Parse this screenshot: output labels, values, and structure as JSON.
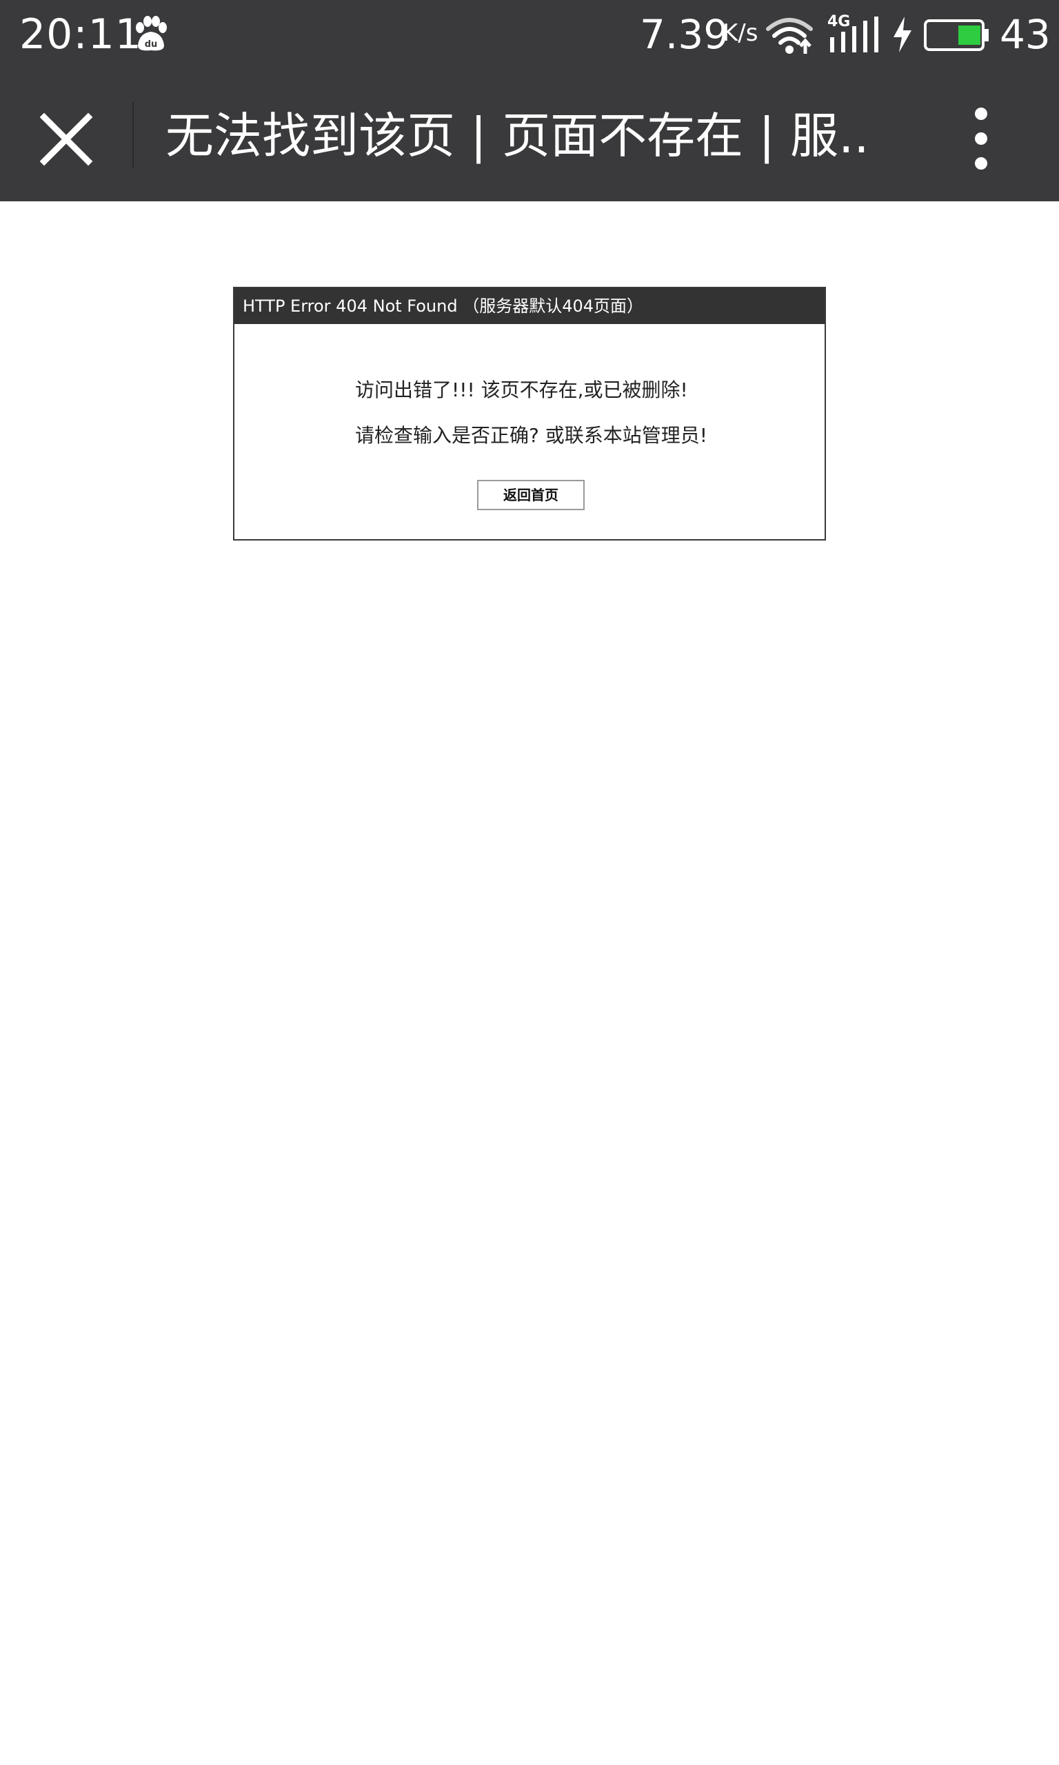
{
  "status_bar": {
    "time": "20:11",
    "notification_icon": "baidu-paw-icon",
    "network_speed": "7.39",
    "network_speed_unit": "K/s",
    "wifi_icon": "wifi-upload-icon",
    "network_type": "4G",
    "signal_icon": "cell-signal-icon",
    "charging_icon": "charging-bolt-icon",
    "battery_icon": "battery-icon",
    "battery_percent": "43",
    "battery_level": 0.43,
    "battery_color": "#2ecc40"
  },
  "app_bar": {
    "close_icon": "close-icon",
    "title": "无法找到该页 | 页面不存在 | 服..",
    "more_icon": "more-vert-icon",
    "background": "#3a3a3c"
  },
  "error_page": {
    "header": "HTTP Error 404 Not Found （服务器默认404页面）",
    "message_line1": "访问出错了!!! 该页不存在,或已被删除!",
    "message_line2": "请检查输入是否正确? 或联系本站管理员!",
    "home_button_label": "返回首页"
  }
}
